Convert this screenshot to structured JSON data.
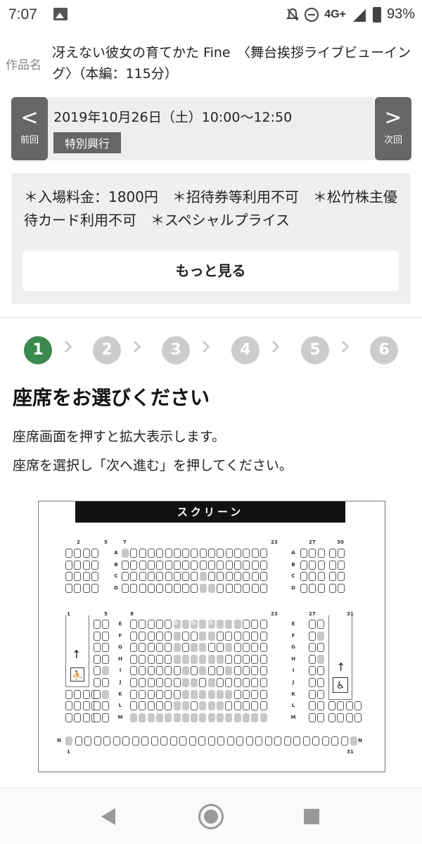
{
  "status_bar": {
    "time": "7:07",
    "network": "4G+",
    "battery": "93%"
  },
  "movie": {
    "label": "作品名",
    "title": "冴えない彼女の育てかた Fine　〈舞台挨拶ライブビューイング〉（本編：115分）"
  },
  "showing": {
    "prev_label": "前回",
    "next_label": "次回",
    "prev_icon": "chevron-left-icon",
    "next_icon": "chevron-right-icon",
    "datetime": "2019年10月26日（土）10:00〜12:50",
    "badge": "特別興行"
  },
  "info": {
    "text": "＊入場料金：1800円　＊招待券等利用不可　＊松竹株主優待カード利用不可　＊スペシャルプライス",
    "more_button": "もっと見る"
  },
  "steps": {
    "items": [
      "1",
      "2",
      "3",
      "4",
      "5",
      "6"
    ],
    "active_index": 0,
    "active_color": "#3a8a4f",
    "inactive_color": "#cccccc"
  },
  "seat_select": {
    "heading": "座席をお選びください",
    "desc1": "座席画面を押すと拡大表示します。",
    "desc2": "座席を選択し「次へ進む」を押してください。"
  },
  "seatmap": {
    "screen_label": "スクリーン",
    "top_col_labels": [
      "2",
      "5",
      "7",
      "23",
      "27",
      "30"
    ],
    "mid_col_labels": [
      "1",
      "5",
      "8",
      "23",
      "27",
      "31"
    ],
    "bottom_col_labels": [
      "1",
      "31"
    ],
    "rows_top": [
      "A",
      "B",
      "C",
      "D"
    ],
    "rows_mid": [
      "E",
      "F",
      "G",
      "H",
      "I",
      "J",
      "K",
      "L",
      "M"
    ],
    "row_bottom": "N",
    "legend_icons": [
      "stairs-icon",
      "wheelchair-icon",
      "up-arrow-icon"
    ]
  },
  "nav_bar": {
    "icons": [
      "back-icon",
      "home-icon",
      "recents-icon"
    ]
  }
}
